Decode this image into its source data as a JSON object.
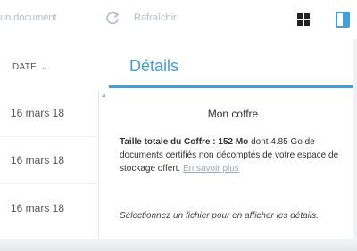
{
  "toolbar": {
    "document_label": "un document",
    "refresh_label": "Rafraîchir",
    "icons": {
      "refresh": "refresh-icon",
      "grid_view": "grid-view-icon",
      "side_panel": "side-panel-icon"
    },
    "accent_color": "#3f9fe0"
  },
  "file_list": {
    "column_header": "DATE",
    "sort_icon": "chevron-down-icon",
    "rows": [
      {
        "date": "16 mars 18"
      },
      {
        "date": "16 mars 18"
      },
      {
        "date": "16 mars 18"
      }
    ]
  },
  "details_panel": {
    "tab_label": "Détails",
    "title": "Mon coffre",
    "total_size_label": "Taille totale du Coffre",
    "total_size_value": "152 Mo",
    "description": "dont 4.85 Go de documents certifiés non décomptés de votre espace de stockage offert.",
    "learn_more": "En savoir plus",
    "hint": "Sélectionnez un fichier pour en afficher les détails."
  }
}
